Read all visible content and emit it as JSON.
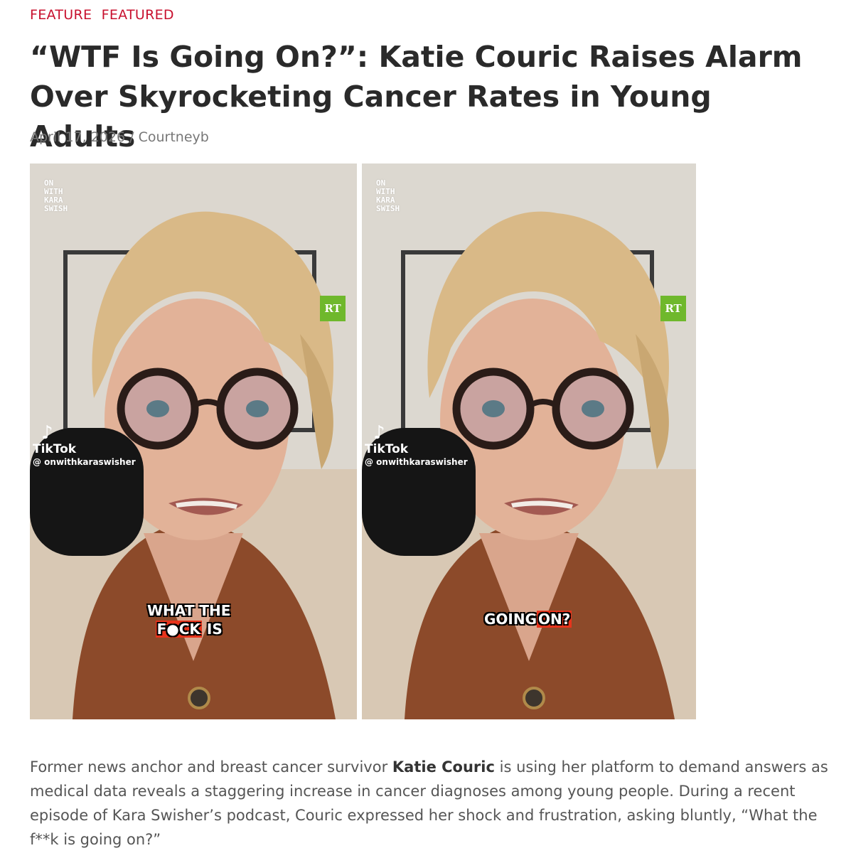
{
  "categories": [
    "FEATURE",
    "FEATURED"
  ],
  "headline": "“WTF Is Going On?”: Katie Couric Raises Alarm Over Skyrocketing Cancer Rates in Young Adults",
  "meta": {
    "date": "April 17, 2026",
    "separator": "/",
    "author": "Courtneyb"
  },
  "images": [
    {
      "logo_lines": [
        "ON",
        "WITH",
        "KARA",
        "SWISH"
      ],
      "rt_label": "RT",
      "tiktok_brand": "TikTok",
      "tiktok_handle": "@ onwithkaraswisher",
      "caption_line1": "WHAT THE",
      "caption_word_censored": "F●CK",
      "caption_word_after": "IS"
    },
    {
      "logo_lines": [
        "ON",
        "WITH",
        "KARA",
        "SWISH"
      ],
      "rt_label": "RT",
      "tiktok_brand": "TikTok",
      "tiktok_handle": "@ onwithkaraswisher",
      "caption_word1": "GOING",
      "caption_word2": "ON?"
    }
  ],
  "article": {
    "p1_before": "Former news anchor and breast cancer survivor ",
    "p1_name": "Katie Couric",
    "p1_after": " is using her platform to demand answers as medical data reveals a staggering increase in cancer diagnoses among young people. During a recent episode of Kara Swisher’s podcast, Couric expressed her shock and frustration, asking bluntly, “What the f**k is going on?”"
  },
  "colors": {
    "category": "#c8102e",
    "headline": "#2a2a2a",
    "meta": "#777777",
    "body_text": "#555555",
    "rt_badge": "#6fb82c",
    "caption_highlight": "#e8341c"
  }
}
